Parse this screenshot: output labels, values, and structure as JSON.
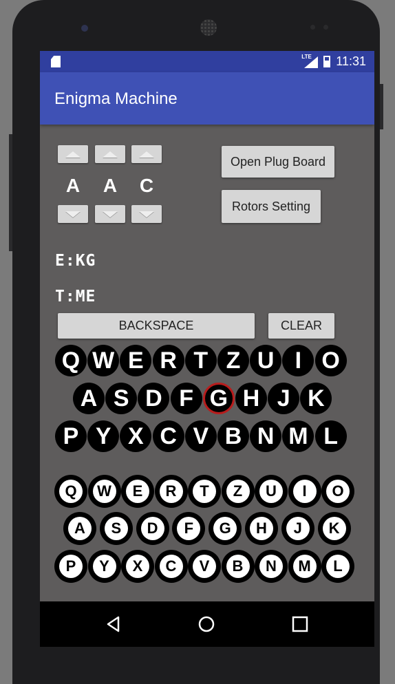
{
  "status_bar": {
    "time": "11:31",
    "network": "LTE"
  },
  "app_bar": {
    "title": "Enigma Machine"
  },
  "rotors": {
    "letters": [
      "A",
      "A",
      "C"
    ]
  },
  "buttons": {
    "plugboard": "Open Plug Board",
    "rotor_settings": "Rotors Setting",
    "backspace": "BACKSPACE",
    "clear": "CLEAR"
  },
  "output": {
    "encrypted": "E:KG",
    "text": "T:ME"
  },
  "keyboard": {
    "rows": [
      [
        "Q",
        "W",
        "E",
        "R",
        "T",
        "Z",
        "U",
        "I",
        "O"
      ],
      [
        "A",
        "S",
        "D",
        "F",
        "G",
        "H",
        "J",
        "K"
      ],
      [
        "P",
        "Y",
        "X",
        "C",
        "V",
        "B",
        "N",
        "M",
        "L"
      ]
    ],
    "highlighted_key": "G"
  },
  "lampboard": {
    "rows": [
      [
        "Q",
        "W",
        "E",
        "R",
        "T",
        "Z",
        "U",
        "I",
        "O"
      ],
      [
        "A",
        "S",
        "D",
        "F",
        "G",
        "H",
        "J",
        "K"
      ],
      [
        "P",
        "Y",
        "X",
        "C",
        "V",
        "B",
        "N",
        "M",
        "L"
      ]
    ]
  },
  "colors": {
    "status_bar": "#303f9f",
    "app_bar": "#3f51b5",
    "background": "#5e5c5c",
    "key_highlight": "#b71c1c"
  }
}
